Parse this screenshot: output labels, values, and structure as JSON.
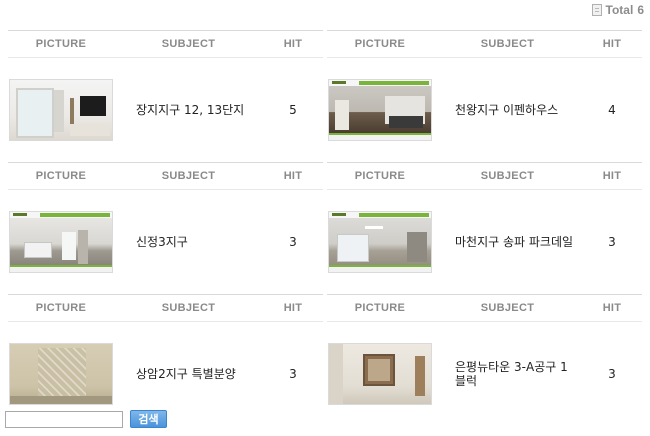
{
  "total": {
    "label": "Total",
    "count": "6"
  },
  "columns": {
    "picture": "PICTURE",
    "subject": "SUBJECT",
    "hit": "HIT"
  },
  "items": [
    {
      "subject": "장지지구 12, 13단지",
      "hit": "5",
      "thumb": "apartment-living-room-photo"
    },
    {
      "subject": "천왕지구 이펜하우스",
      "hit": "4",
      "thumb": "virtual-tour-kitchen-photo"
    },
    {
      "subject": "신정3지구",
      "hit": "3",
      "thumb": "virtual-tour-living-room-photo"
    },
    {
      "subject": "마천지구 송파 파크데일",
      "hit": "3",
      "thumb": "virtual-tour-room-photo"
    },
    {
      "subject": "상암2지구 특별분양",
      "hit": "3",
      "thumb": "patterned-wall-photo"
    },
    {
      "subject": "은평뉴타운 3-A공구 1블럭",
      "hit": "3",
      "thumb": "room-window-photo"
    }
  ],
  "search": {
    "value": "",
    "button_label": "검색"
  }
}
